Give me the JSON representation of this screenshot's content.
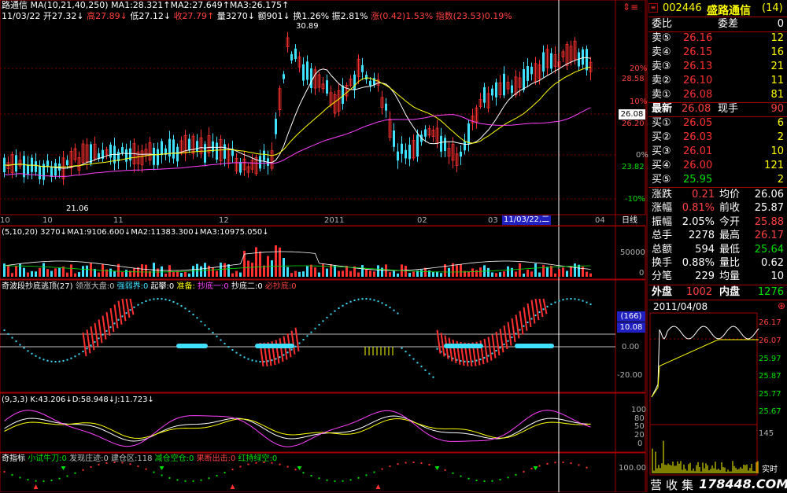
{
  "header": {
    "line1": "路通信 MA(10,21,40,250) MA1:28.321↑MA2:27.649↑MA3:26.175↑",
    "line2_date": "11/03/22",
    "line2_open": "开27.32↓",
    "line2_high": "高27.89↓",
    "line2_low": "低27.12↓",
    "line2_close": "收27.79↑",
    "line2_vol": "量3270↓",
    "line2_amount": "额901↓",
    "line2_turn": "换1.26%",
    "line2_amp": "振2.81%",
    "line2_chg": "涨(0.42)1.53%",
    "line2_idx": "指数(23.53)0.19%"
  },
  "main_chart": {
    "high_marker": "30.89",
    "low_marker": "21.06",
    "right_axis": [
      "20%",
      "28.58",
      "10%",
      "26.20",
      "0%",
      "23.82",
      "-10%"
    ],
    "current_price_tag": "26.08"
  },
  "time_axis": {
    "labels": [
      "10",
      "10",
      "11",
      "12",
      "2011",
      "02",
      "03",
      "11/03/22,二",
      "04"
    ],
    "period": "日线"
  },
  "volume_panel": {
    "title": "(5,10,20) 3270↓MA1:9106.600↓MA2:11383.300↓MA3:10975.050↓",
    "axis": [
      "50000",
      "0"
    ]
  },
  "wave_panel": {
    "title_prefix": "奇波段抄底逃顶(27)",
    "items": [
      {
        "text": "领涨大盘:0",
        "color": "#c0c0c0"
      },
      {
        "text": "强弱界:0",
        "color": "#40e0ff"
      },
      {
        "text": "起攀:0",
        "color": "#ffffff"
      },
      {
        "text": "准备:",
        "color": "#ffff00"
      },
      {
        "text": "抄底一:0",
        "color": "#ff40ff"
      },
      {
        "text": "抄底二:0",
        "color": "#ffffff"
      },
      {
        "text": "必抄底:0",
        "color": "#ff4040"
      }
    ],
    "box1": "(166)",
    "box2": "10.08",
    "axis": [
      "0.00",
      "-20.00"
    ]
  },
  "kdj_panel": {
    "title": "(9,3,3) K:43.206↓D:58.948↓J:11.723↓",
    "axis": [
      "100",
      "80",
      "50",
      "20",
      "0"
    ]
  },
  "signal_panel": {
    "title_prefix": "奇指标",
    "items": [
      {
        "text": "小试牛刀:0",
        "color": "#00e000"
      },
      {
        "text": "发现庄迹:0",
        "color": "#c0c0c0"
      },
      {
        "text": "建仓区:118",
        "color": "#c0c0c0"
      },
      {
        "text": "减仓空仓:0",
        "color": "#00e000"
      },
      {
        "text": "果断出击:0",
        "color": "#ff4040"
      },
      {
        "text": "红持绿空:0",
        "color": "#00e000"
      }
    ],
    "axis": "100.00"
  },
  "quote": {
    "code": "002446",
    "name": "盛路通信",
    "count": "(14)",
    "weibi_label": "委比",
    "weicha_label": "委差",
    "weicha_value": "0",
    "asks": [
      {
        "label": "卖⑤",
        "price": "26.16",
        "vol": "12"
      },
      {
        "label": "卖④",
        "price": "26.15",
        "vol": "16"
      },
      {
        "label": "卖③",
        "price": "26.13",
        "vol": "21"
      },
      {
        "label": "卖②",
        "price": "26.10",
        "vol": "11"
      },
      {
        "label": "卖①",
        "price": "26.08",
        "vol": "81"
      }
    ],
    "latest_label": "最新",
    "latest_price": "26.08",
    "current_hand_label": "现手",
    "current_hand": "90",
    "bids": [
      {
        "label": "买①",
        "price": "26.05",
        "vol": "6"
      },
      {
        "label": "买②",
        "price": "26.03",
        "vol": "2"
      },
      {
        "label": "买③",
        "price": "26.01",
        "vol": "10"
      },
      {
        "label": "买④",
        "price": "26.00",
        "vol": "121"
      },
      {
        "label": "买⑤",
        "price": "25.95",
        "vol": "2"
      }
    ],
    "stats": [
      {
        "l1": "涨跌",
        "v1": "0.21",
        "l2": "均价",
        "v2": "26.06",
        "c1": "#ff4040",
        "c2": "#ffffff"
      },
      {
        "l1": "涨幅",
        "v1": "0.81%",
        "l2": "前收",
        "v2": "25.87",
        "c1": "#ff4040",
        "c2": "#ffffff"
      },
      {
        "l1": "振幅",
        "v1": "2.05%",
        "l2": "今开",
        "v2": "25.88",
        "c1": "#ffffff",
        "c2": "#ff4040"
      },
      {
        "l1": "总手",
        "v1": "2278",
        "l2": "最高",
        "v2": "26.17",
        "c1": "#ffffff",
        "c2": "#ff4040"
      },
      {
        "l1": "总额",
        "v1": "594",
        "l2": "最低",
        "v2": "25.64",
        "c1": "#ffffff",
        "c2": "#00e000"
      },
      {
        "l1": "换手",
        "v1": "0.88%",
        "l2": "量比",
        "v2": "0.62",
        "c1": "#ffffff",
        "c2": "#ffffff"
      },
      {
        "l1": "分笔",
        "v1": "229",
        "l2": "均量",
        "v2": "10",
        "c1": "#ffffff",
        "c2": "#ffffff"
      }
    ],
    "outer_label": "外盘",
    "outer_value": "1002",
    "inner_label": "内盘",
    "inner_value": "1276"
  },
  "mini_chart": {
    "date": "2011/04/08",
    "axis": [
      "26.17",
      "26.07",
      "25.97",
      "25.87",
      "25.77",
      "25.67"
    ],
    "vol_axis": "145",
    "tab_label": "实时"
  },
  "bottom_tabs": [
    "营",
    "收",
    "集"
  ],
  "watermark": "178448.COM",
  "colors": {
    "up": "#ff3030",
    "down": "#40e0ff",
    "frame": "#a00000",
    "ma1": "#ffffff",
    "ma2": "#ffff00",
    "ma3": "#ff40ff"
  }
}
